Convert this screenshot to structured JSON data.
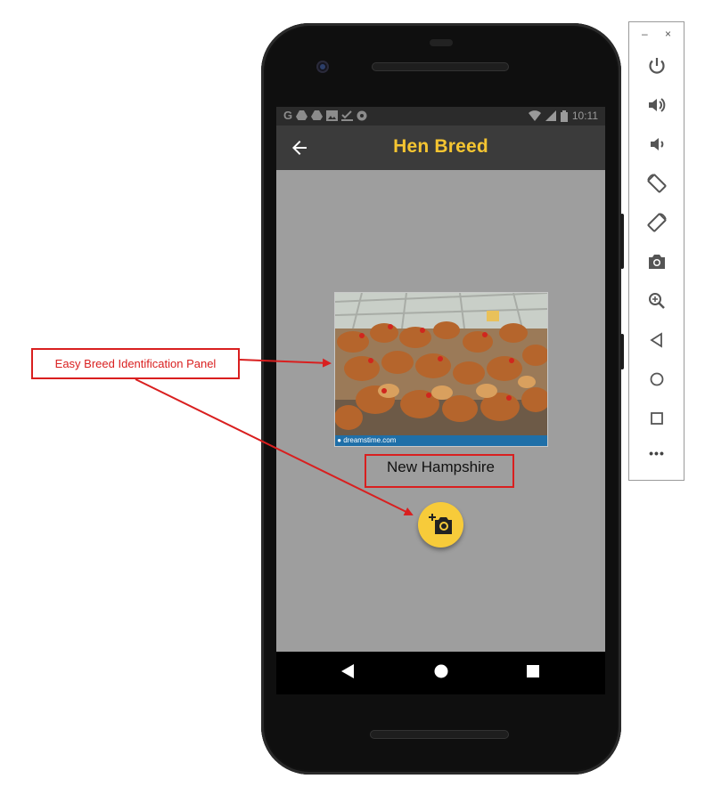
{
  "status_bar": {
    "left_icons": [
      "G",
      "drive-icon",
      "drive-icon",
      "photo-icon",
      "check-icon",
      "settings-icon"
    ],
    "time": "10:11"
  },
  "app_bar": {
    "title": "Hen Breed",
    "title_color": "#f5c531"
  },
  "main": {
    "image_watermark": "dreamstime.com",
    "breed_name": "New Hampshire",
    "fab_icon": "add-a-photo-icon",
    "fab_color": "#f7cb3a"
  },
  "annotations": {
    "panel_label": "Easy Breed Identification Panel",
    "color": "#d91f1f"
  },
  "emulator": {
    "minimize": "–",
    "close": "×",
    "controls": [
      "power-icon",
      "volume-up-icon",
      "volume-down-icon",
      "rotate-left-icon",
      "rotate-right-icon",
      "camera-icon",
      "zoom-icon",
      "back-icon",
      "home-icon",
      "overview-icon",
      "more-icon"
    ],
    "more_label": "•••"
  }
}
